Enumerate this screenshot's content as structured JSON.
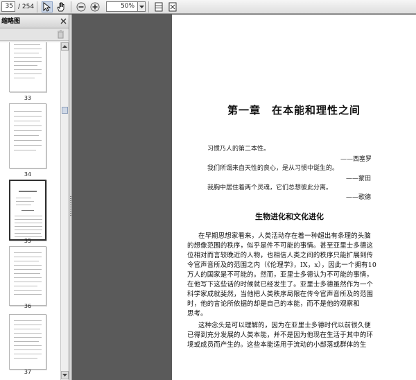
{
  "toolbar": {
    "current_page": "35",
    "page_total": "/ 254",
    "zoom": "50%"
  },
  "sidebar": {
    "title": "缩略图",
    "thumbnails": [
      {
        "number": "33"
      },
      {
        "number": "34"
      },
      {
        "number": "35",
        "selected": true
      },
      {
        "number": "36"
      },
      {
        "number": "37"
      }
    ]
  },
  "document": {
    "chapter_title": "第一章　在本能和理性之间",
    "epigraphs": [
      {
        "text": "习惯乃人的第二本性。",
        "author": "——西塞罗"
      },
      {
        "text": "我们所谓来自天性的良心，是从习惯中诞生的。",
        "author": "——蒙田"
      },
      {
        "text": "我胸中居住着两个灵魂，它们总想彼此分离。",
        "author": "——歌德"
      }
    ],
    "section_title": "生物进化和文化进化",
    "body_lines": [
      "在早期思想家看来，人类活动存在着一种超出有条理的头脑",
      "的想像范围的秩序，似乎是件不可能的事情。甚至亚里士多德这",
      "位相对而言较晚近的人物，也相信人类之间的秩序只能扩展到传",
      "令官声音所及的范围之内（《伦理学》，IX，x），因此一个拥有10",
      "万人的国家是不可能的。然而，亚里士多德认为不可能的事情，",
      "在他写下这些话的时候就已经发生了。亚里士多德虽然作为一个",
      "科学家成就斐然，当他把人类秩序局限在传令官声音所及的范围",
      "时，他的言论所依据的却是自己的本能，而不是他的观察和",
      "思考。",
      "这种念头是可以理解的，因为在亚里士多德时代以前很久便",
      "已得到充分发展的人类本能，并不是因为他现在生活于其中的环",
      "境或成员而产生的。这些本能适用于流动的小部落或群体的生"
    ]
  }
}
